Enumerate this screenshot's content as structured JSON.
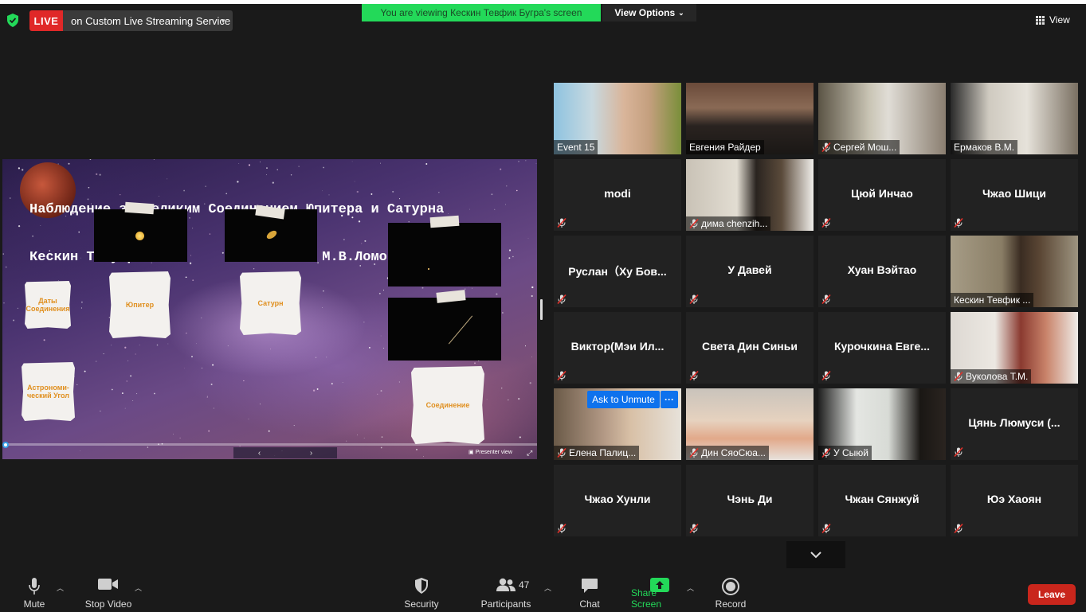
{
  "top_bar": {
    "live_badge": "LIVE",
    "live_service": "on Custom Live Streaming Service",
    "viewing_banner": "You are viewing Кескин Тевфик Бугра's screen",
    "view_options": "View Options",
    "view_button": "View",
    "colors": {
      "live": "#e02828",
      "banner": "#23d959"
    }
  },
  "shared_screen": {
    "title_line1": "Наблюдение за Великим Соединением Юпитера и Сатурна",
    "title_line2": "Кескин Т.Бугра            МГУ имени М.В.Ломоносова",
    "notes": [
      {
        "text": "Даты Соединения"
      },
      {
        "text": "Юпитер"
      },
      {
        "text": "Сатурн"
      },
      {
        "text": "Астрономи-ческий Угол"
      },
      {
        "text": "Соединение"
      }
    ],
    "presenter_view": "Presenter view"
  },
  "gallery": {
    "ask_to_unmute": "Ask to Unmute",
    "more": "···",
    "tiles": [
      {
        "name": "Event 15",
        "muted": false,
        "video": true
      },
      {
        "name": "Евгения Райдер",
        "muted": false,
        "video": true
      },
      {
        "name": "Сергей Мош...",
        "muted": true,
        "video": true
      },
      {
        "name": "Ермаков В.М.",
        "muted": false,
        "video": true
      },
      {
        "name": "modi",
        "muted": true,
        "video": false
      },
      {
        "name": "дима chenzih...",
        "muted": true,
        "video": true
      },
      {
        "name": "Цюй Инчао",
        "muted": true,
        "video": false
      },
      {
        "name": "Чжао Шици",
        "muted": true,
        "video": false
      },
      {
        "name": "Руслан（Ху Бов...",
        "muted": true,
        "video": false
      },
      {
        "name": "У Давей",
        "muted": true,
        "video": false
      },
      {
        "name": "Хуан Вэйтао",
        "muted": true,
        "video": false
      },
      {
        "name": "Кескин Тевфик ...",
        "muted": false,
        "video": true,
        "active": true
      },
      {
        "name": "Виктор(Мэи Ил...",
        "muted": true,
        "video": false
      },
      {
        "name": "Света Дин Синьи",
        "muted": true,
        "video": false
      },
      {
        "name": "Курочкина  Евге...",
        "muted": true,
        "video": false
      },
      {
        "name": "Вуколова Т.М.",
        "muted": true,
        "video": true
      },
      {
        "name": "Елена Палиц...",
        "muted": true,
        "video": true
      },
      {
        "name": "Дин СяоСюа...",
        "muted": true,
        "video": true
      },
      {
        "name": "У Сыюй",
        "muted": true,
        "video": true
      },
      {
        "name": "Цянь Люмуси (...",
        "muted": true,
        "video": false
      },
      {
        "name": "Чжао Хунли",
        "muted": true,
        "video": false
      },
      {
        "name": "Чэнь Ди",
        "muted": true,
        "video": false
      },
      {
        "name": "Чжан Сянжуй",
        "muted": true,
        "video": false
      },
      {
        "name": "Юэ Хаоян",
        "muted": true,
        "video": false
      }
    ]
  },
  "toolbar": {
    "mute": "Mute",
    "stop_video": "Stop Video",
    "security": "Security",
    "participants": "Participants",
    "participants_count": "47",
    "chat": "Chat",
    "share_screen": "Share Screen",
    "record": "Record",
    "leave": "Leave"
  }
}
